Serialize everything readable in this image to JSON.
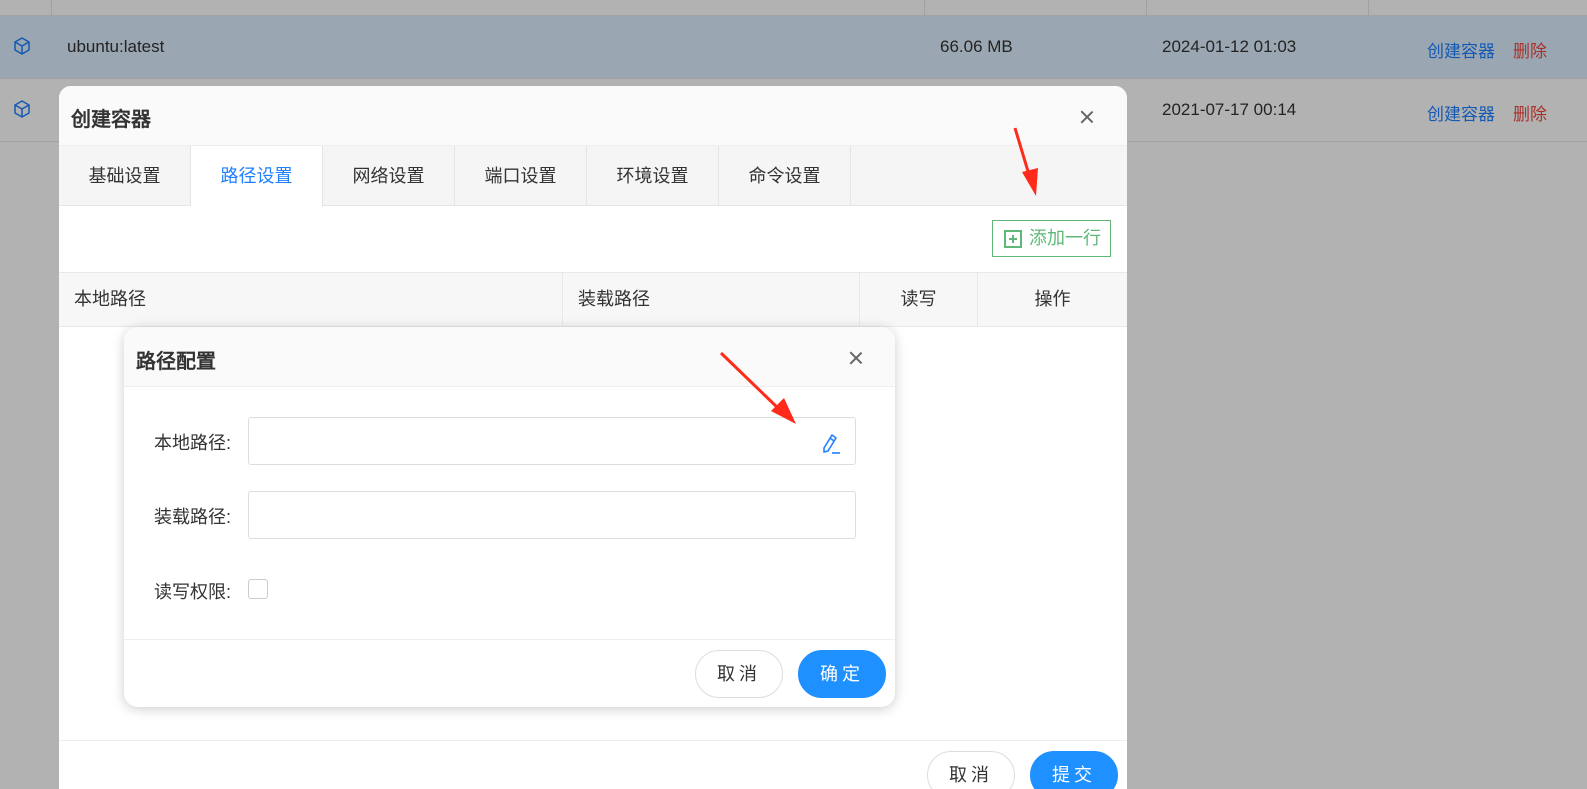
{
  "image_list": {
    "rows": [
      {
        "name": "ubuntu:latest",
        "size": "66.06 MB",
        "date": "2024-01-12 01:03",
        "action_create": "创建容器",
        "action_delete": "删除",
        "highlighted": true
      },
      {
        "name": "",
        "size": "",
        "date": "2021-07-17 00:14",
        "action_create": "创建容器",
        "action_delete": "删除",
        "highlighted": false
      }
    ]
  },
  "create_dialog": {
    "title": "创建容器",
    "tabs": [
      {
        "label": "基础设置",
        "active": false
      },
      {
        "label": "路径设置",
        "active": true
      },
      {
        "label": "网络设置",
        "active": false
      },
      {
        "label": "端口设置",
        "active": false
      },
      {
        "label": "环境设置",
        "active": false
      },
      {
        "label": "命令设置",
        "active": false
      }
    ],
    "add_row_label": "添加一行",
    "table_headers": {
      "local_path": "本地路径",
      "mount_path": "装载路径",
      "read_write": "读写",
      "operation": "操作"
    },
    "cancel_label": "取消",
    "submit_label": "提交"
  },
  "path_dialog": {
    "title": "路径配置",
    "local_path_label": "本地路径:",
    "local_path_value": "",
    "mount_path_label": "装载路径:",
    "mount_path_value": "",
    "rw_label": "读写权限:",
    "rw_checked": false,
    "cancel_label": "取消",
    "confirm_label": "确定"
  },
  "colors": {
    "primary": "#1e90ff",
    "link": "#1e80ff",
    "danger": "#f0483e",
    "success": "#5fb878",
    "annotation_arrow": "#ff2a1a"
  }
}
